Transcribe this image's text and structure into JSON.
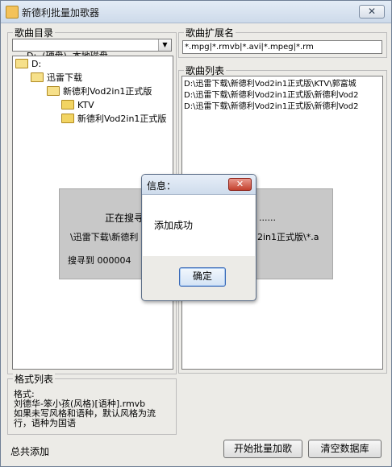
{
  "window": {
    "title": "新德利批量加歌器",
    "close_glyph": "✕"
  },
  "directory_panel": {
    "label": "歌曲目录",
    "drive_select": {
      "value": "D:  (硬盘)  本地磁盘"
    },
    "tree": [
      {
        "label": "D:",
        "level": 0
      },
      {
        "label": "迅雷下载",
        "level": 1
      },
      {
        "label": "新德利Vod2in1正式版",
        "level": 2
      },
      {
        "label": "KTV",
        "level": 3
      },
      {
        "label": "新德利Vod2in1正式版",
        "level": 3
      }
    ]
  },
  "extension_panel": {
    "label": "歌曲扩展名",
    "value": "*.mpg|*.rmvb|*.avi|*.mpeg|*.rm"
  },
  "song_list_panel": {
    "label": "歌曲列表",
    "items": [
      "D:\\迅雷下载\\新德利Vod2in1正式版\\KTV\\郭富城",
      "D:\\迅雷下载\\新德利Vod2in1正式版\\新德利Vod2",
      "D:\\迅雷下载\\新德利Vod2in1正式版\\新德利Vod2"
    ]
  },
  "search_progress": {
    "line1_left": "正在搜寻",
    "line1_right": "......",
    "line2_left": "\\迅雷下载\\新德利",
    "line2_right": "2in1正式版\\*.a",
    "found_label": "搜寻到 000004"
  },
  "dialog": {
    "title": "信息：",
    "close_glyph": "✕",
    "message": "添加成功",
    "ok_label": "确定"
  },
  "format_panel": {
    "label": "格式列表",
    "lines": [
      "格式:",
      "刘德华-笨小孩(风格)[语种].rmvb",
      "如果未写风格和语种，默认风格为流",
      "行，语种为国语"
    ]
  },
  "footer": {
    "total_label": "总共添加",
    "start_button": "开始批量加歌",
    "clear_button": "清空数据库"
  }
}
